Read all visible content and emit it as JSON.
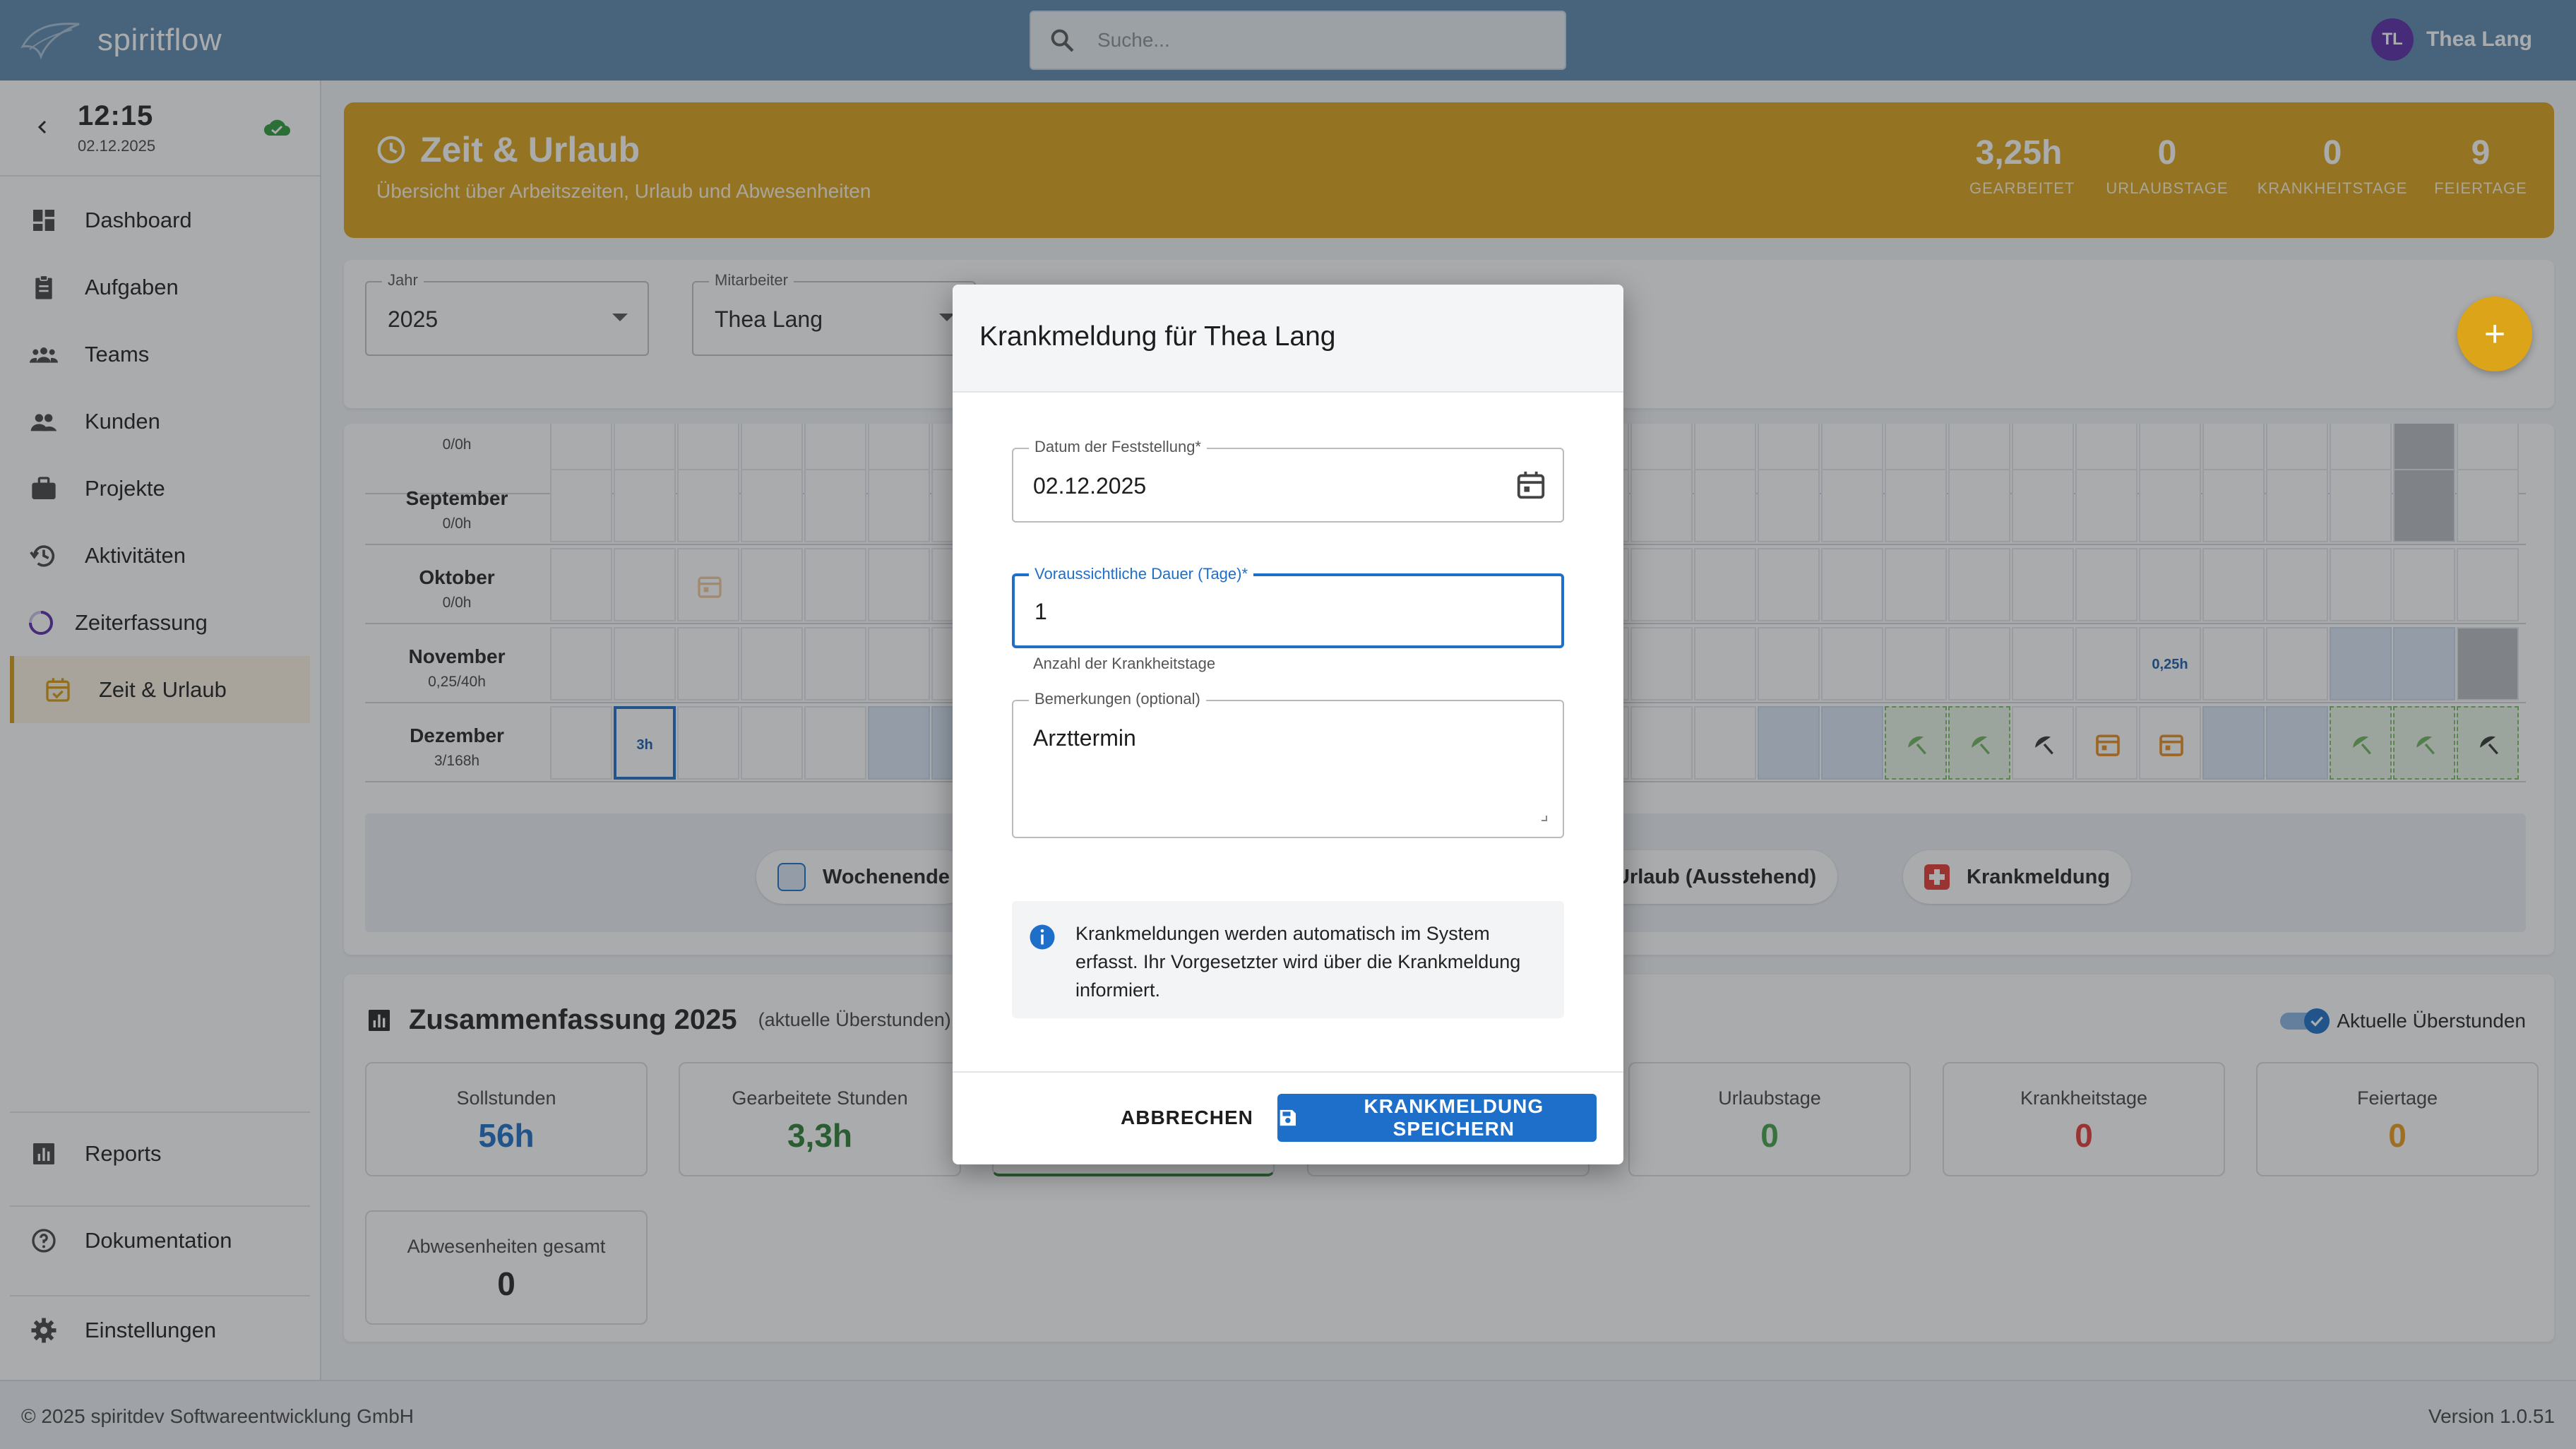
{
  "app": {
    "name": "spiritflow"
  },
  "search": {
    "placeholder": "Suche..."
  },
  "user": {
    "initials": "TL",
    "name": "Thea Lang"
  },
  "clock": {
    "time": "12:15",
    "date": "02.12.2025"
  },
  "nav": {
    "items": [
      {
        "label": "Dashboard",
        "icon": "dashboard-icon"
      },
      {
        "label": "Aufgaben",
        "icon": "clipboard-icon"
      },
      {
        "label": "Teams",
        "icon": "groups-icon"
      },
      {
        "label": "Kunden",
        "icon": "people-icon"
      },
      {
        "label": "Projekte",
        "icon": "briefcase-icon"
      },
      {
        "label": "Aktivitäten",
        "icon": "history-icon"
      },
      {
        "label": "Zeiterfassung",
        "icon": "progress-circle-icon"
      },
      {
        "label": "Zeit & Urlaub",
        "icon": "calendar-check-icon",
        "active": true
      }
    ],
    "bottom": [
      {
        "label": "Reports",
        "icon": "bar-chart-icon"
      },
      {
        "label": "Dokumentation",
        "icon": "help-circle-icon"
      },
      {
        "label": "Einstellungen",
        "icon": "gear-icon"
      }
    ]
  },
  "hero": {
    "title": "Zeit & Urlaub",
    "subtitle": "Übersicht über Arbeitszeiten, Urlaub und Abwesenheiten",
    "stats": [
      {
        "value": "3,25h",
        "label": "GEARBEITET"
      },
      {
        "value": "0",
        "label": "URLAUBSTAGE"
      },
      {
        "value": "0",
        "label": "KRANKHEITSTAGE"
      },
      {
        "value": "9",
        "label": "FEIERTAGE"
      }
    ]
  },
  "filters": {
    "year": {
      "label": "Jahr",
      "value": "2025"
    },
    "employee": {
      "label": "Mitarbeiter",
      "value": "Thea Lang"
    },
    "add_label": "+"
  },
  "calendar": {
    "months": [
      {
        "name": "",
        "hours": "0/0h"
      },
      {
        "name": "September",
        "hours": "0/0h"
      },
      {
        "name": "Oktober",
        "hours": "0/0h"
      },
      {
        "name": "November",
        "hours": "0,25/40h"
      },
      {
        "name": "Dezember",
        "hours": "3/168h"
      }
    ],
    "cell_labels": {
      "dec_3h": "3h",
      "nov_025h": "0,25h"
    },
    "legend": [
      {
        "label": "Wochenende",
        "color": "#dbe7f6"
      },
      {
        "label": "Urlaub (Ausstehend)",
        "color": "#ffffff"
      },
      {
        "label": "Krankmeldung",
        "color": "#e53935"
      }
    ]
  },
  "summary": {
    "title": "Zusammenfassung 2025",
    "subtitle": "(aktuelle Überstunden)",
    "toggle_label": "Aktuelle Überstunden",
    "cards": [
      {
        "label": "Sollstunden",
        "value": "56h",
        "color": "#1e6fc9"
      },
      {
        "label": "Gearbeitete Stunden",
        "value": "3,3h",
        "color": "#2e7d32"
      },
      {
        "label": "Urlaubstage",
        "value": "0",
        "color": "#43a047"
      },
      {
        "label": "Krankheitstage",
        "value": "0",
        "color": "#e53935"
      },
      {
        "label": "Feiertage",
        "value": "0",
        "color": "#ef9a1a"
      },
      {
        "label": "Abwesenheiten gesamt",
        "value": "0",
        "color": "#222222"
      }
    ]
  },
  "dialog": {
    "title": "Krankmeldung für Thea Lang",
    "date_field": {
      "label": "Datum der Feststellung*",
      "value": "02.12.2025"
    },
    "duration_field": {
      "label": "Voraussichtliche Dauer (Tage)*",
      "value": "1",
      "helper": "Anzahl der Krankheitstage"
    },
    "remarks_field": {
      "label": "Bemerkungen (optional)",
      "value": "Arzttermin"
    },
    "info_text": "Krankmeldungen werden automatisch im System erfasst. Ihr Vorgesetzter wird über die Krankmeldung informiert.",
    "cancel_label": "ABBRECHEN",
    "save_label": "KRANKMELDUNG SPEICHERN"
  },
  "footer": {
    "copyright": "© 2025 spiritdev Softwareentwicklung GmbH",
    "version": "Version 1.0.51"
  }
}
